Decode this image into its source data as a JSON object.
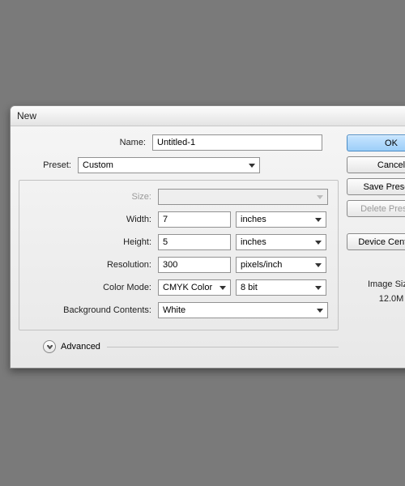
{
  "dialog": {
    "title": "New",
    "name_label": "Name:",
    "name_value": "Untitled-1",
    "preset_label": "Preset:",
    "preset_value": "Custom",
    "size_label": "Size:",
    "size_value": "",
    "width_label": "Width:",
    "width_value": "7",
    "width_unit": "inches",
    "height_label": "Height:",
    "height_value": "5",
    "height_unit": "inches",
    "resolution_label": "Resolution:",
    "resolution_value": "300",
    "resolution_unit": "pixels/inch",
    "color_mode_label": "Color Mode:",
    "color_mode_value": "CMYK Color",
    "bit_depth": "8 bit",
    "bg_label": "Background Contents:",
    "bg_value": "White",
    "advanced_label": "Advanced"
  },
  "buttons": {
    "ok": "OK",
    "cancel": "Cancel",
    "save_preset": "Save Preset...",
    "delete_preset": "Delete Preset...",
    "device_central": "Device Central..."
  },
  "info": {
    "image_size_label": "Image Size:",
    "image_size_value": "12.0M"
  }
}
